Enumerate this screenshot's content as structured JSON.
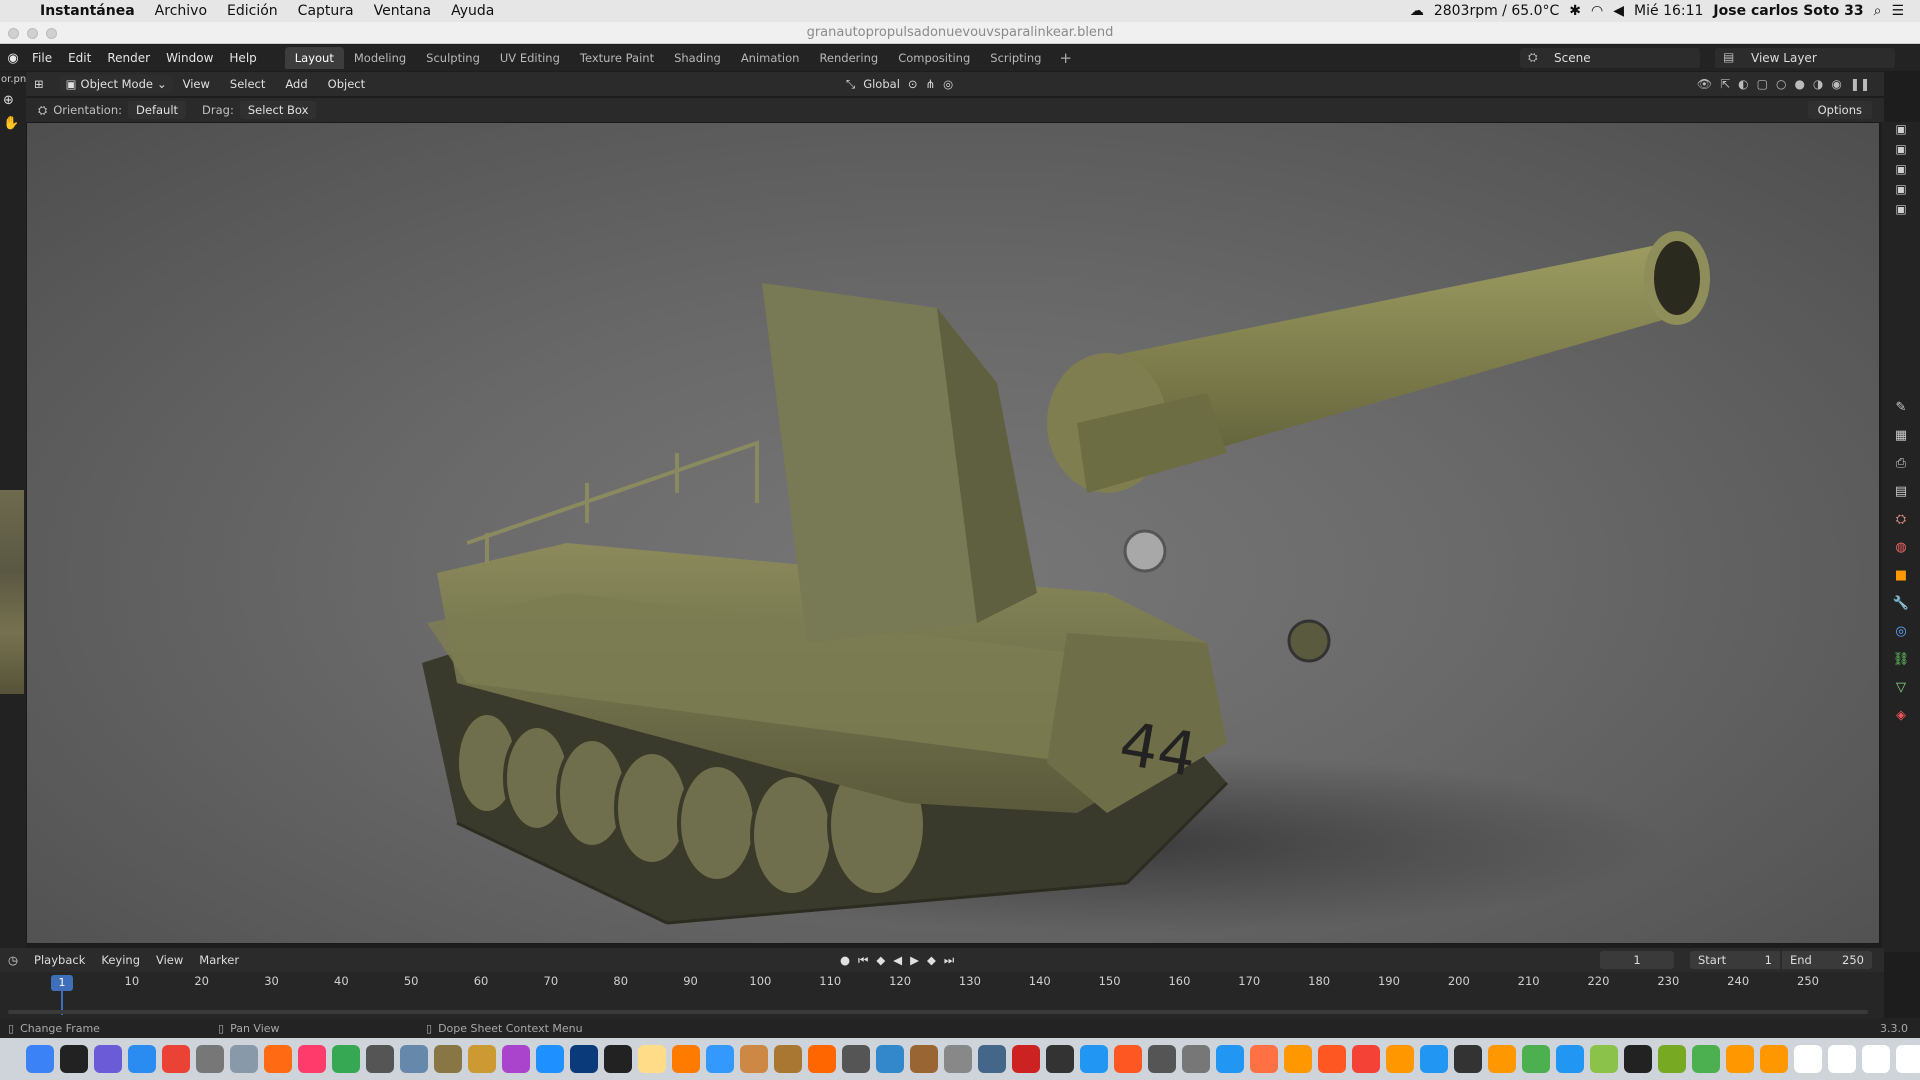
{
  "macbar": {
    "app": "Instantánea",
    "menus": [
      "Archivo",
      "Edición",
      "Captura",
      "Ventana",
      "Ayuda"
    ],
    "status_fan": "2803rpm / 65.0°C",
    "clock": "Mié 16:11",
    "user": "Jose carlos Soto 33"
  },
  "window": {
    "title": "granautopropulsadonuevouvsparalinkear.blend"
  },
  "topbar": {
    "menus": [
      "File",
      "Edit",
      "Render",
      "Window",
      "Help"
    ],
    "workspaces": [
      "Layout",
      "Modeling",
      "Sculpting",
      "UV Editing",
      "Texture Paint",
      "Shading",
      "Animation",
      "Rendering",
      "Compositing",
      "Scripting"
    ],
    "active_workspace": "Layout",
    "add": "+",
    "scene": "Scene",
    "view_layer": "View Layer"
  },
  "header": {
    "partial_left": "or.pn",
    "mode": "Object Mode",
    "menus": [
      "View",
      "Select",
      "Add",
      "Object"
    ],
    "transform_orientation": "Global"
  },
  "toolrow": {
    "orientation_label": "Orientation:",
    "orientation_value": "Default",
    "drag_label": "Drag:",
    "drag_value": "Select Box",
    "options": "Options"
  },
  "scene3d": {
    "subject": "self-propelled artillery tank model",
    "hull_number": "44",
    "colors": {
      "body": "#7a7a4e",
      "body_dark": "#4a4a30",
      "barrel": "#8a8a55",
      "track": "#3a3a2c",
      "background": "#6a6a6a"
    }
  },
  "timeline": {
    "menus": [
      "Playback",
      "Keying",
      "View",
      "Marker"
    ],
    "current_frame": "1",
    "start_label": "Start",
    "start_value": "1",
    "end_label": "End",
    "end_value": "250",
    "ticks": [
      "1",
      "10",
      "20",
      "30",
      "40",
      "50",
      "60",
      "70",
      "80",
      "90",
      "100",
      "110",
      "120",
      "130",
      "140",
      "150",
      "160",
      "170",
      "180",
      "190",
      "200",
      "210",
      "220",
      "230",
      "240",
      "250"
    ]
  },
  "statusbar": {
    "change_frame": "Change Frame",
    "pan_view": "Pan View",
    "context_menu": "Dope Sheet Context Menu",
    "version": "3.3.0"
  },
  "dock_colors": [
    "#3b82f6",
    "#222222",
    "#6b5bd6",
    "#2a8cf0",
    "#ea4335",
    "#777777",
    "#8899aa",
    "#ff6a13",
    "#ff3b6b",
    "#36a853",
    "#555555",
    "#6688aa",
    "#887744",
    "#cc9933",
    "#aa44cc",
    "#1e90ff",
    "#0a3a7a",
    "#222222",
    "#ffdd88",
    "#ff7b00",
    "#3399ff",
    "#cc8844",
    "#aa7733",
    "#ff6600",
    "#555555",
    "#3388cc",
    "#996633",
    "#888888",
    "#446688",
    "#cc2222",
    "#333333",
    "#2196f3",
    "#ff5722",
    "#555555",
    "#777777",
    "#2196f3",
    "#ff7043",
    "#ff9800",
    "#ff5722",
    "#f44336",
    "#ff9800",
    "#2196f3",
    "#333333",
    "#ff9800",
    "#4caf50",
    "#2196f3",
    "#8bc34a",
    "#222222",
    "#77aa22",
    "#4caf50",
    "#ff9800",
    "#ff9800",
    "#ffffff",
    "#ffffff",
    "#ffffff",
    "#ffffff",
    "#dddddd"
  ]
}
